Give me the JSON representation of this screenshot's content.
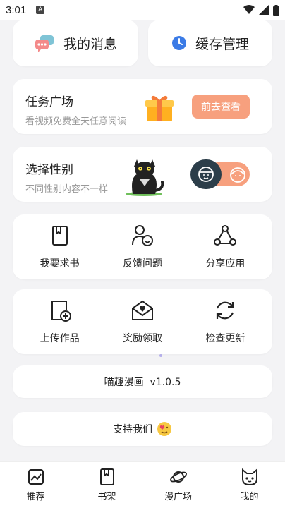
{
  "status_bar": {
    "time": "3:01",
    "badge": "A"
  },
  "messages": {
    "label": "我的消息"
  },
  "cache": {
    "label": "缓存管理"
  },
  "tasks": {
    "title": "任务广场",
    "subtitle": "看视频免费全天任意阅读",
    "button": "前去查看"
  },
  "gender": {
    "title": "选择性别",
    "subtitle": "不同性别内容不一样"
  },
  "grid1": {
    "items": [
      {
        "label": "我要求书"
      },
      {
        "label": "反馈问题"
      },
      {
        "label": "分享应用"
      }
    ]
  },
  "grid2": {
    "items": [
      {
        "label": "上传作品"
      },
      {
        "label": "奖励领取"
      },
      {
        "label": "检查更新"
      }
    ]
  },
  "version": {
    "text": "喵趣漫画  v1.0.5"
  },
  "support": {
    "text": "支持我们"
  },
  "tabbar": {
    "items": [
      {
        "label": "推荐"
      },
      {
        "label": "书架"
      },
      {
        "label": "漫广场"
      },
      {
        "label": "我的"
      }
    ]
  },
  "colors": {
    "accent": "#f7a07e",
    "background": "#f3f3f5",
    "dark_toggle": "#2c3e4a"
  }
}
